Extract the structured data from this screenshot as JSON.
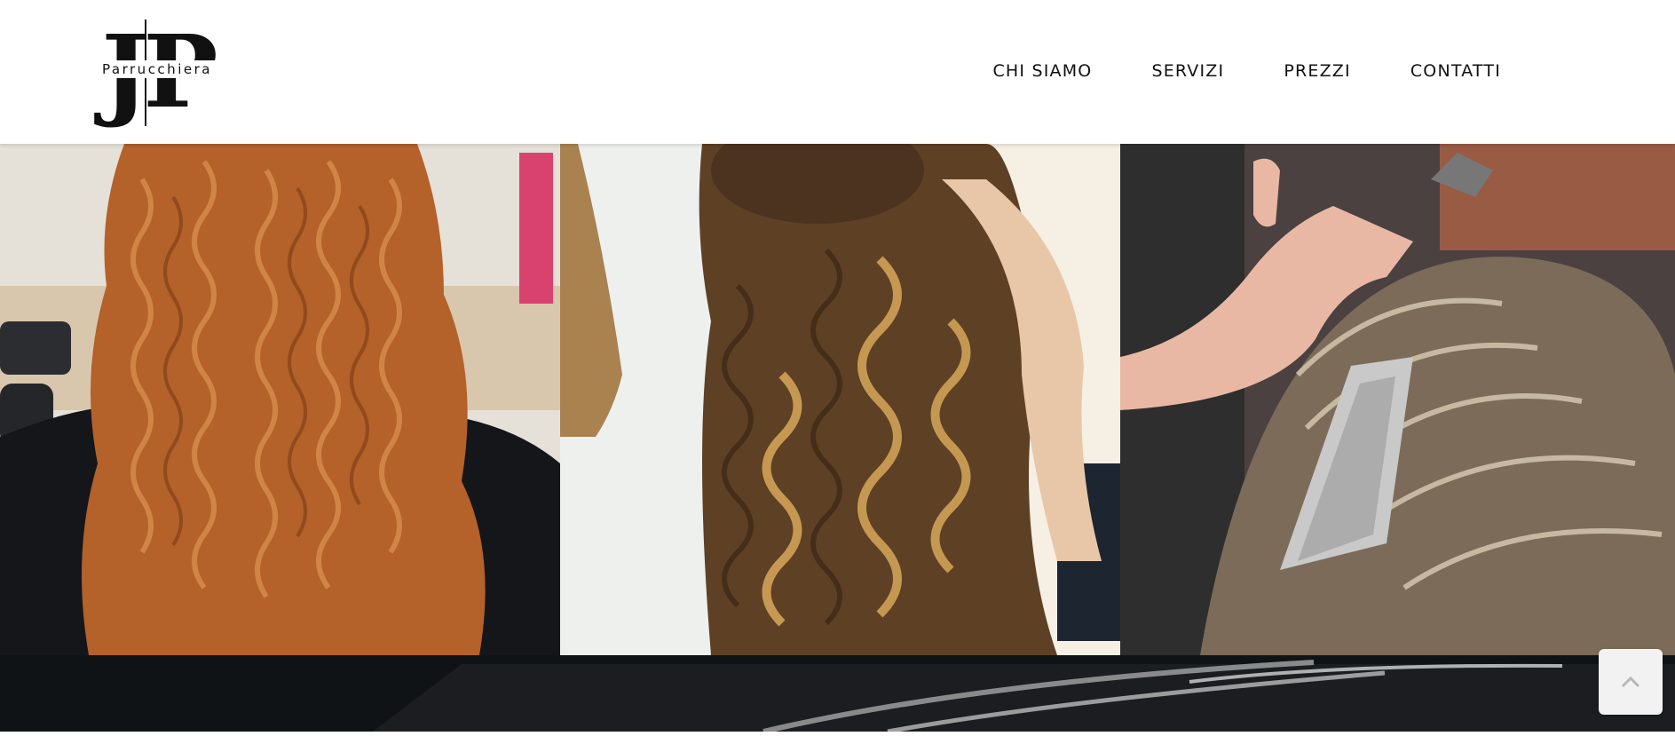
{
  "header": {
    "logo": {
      "monogram": "JP",
      "subtitle": "Parrucchiera"
    },
    "nav": [
      "CHI SIAMO",
      "SERVIZI",
      "PREZZI",
      "CONTATTI"
    ]
  },
  "gallery": {
    "images": [
      {
        "subject": "long-curly-copper-hair-back-view"
      },
      {
        "subject": "brown-blonde-spiral-curls-side-view"
      },
      {
        "subject": "hair-highlights-foil-application"
      }
    ]
  },
  "scroll_top": {
    "icon": "chevron-up-icon"
  }
}
